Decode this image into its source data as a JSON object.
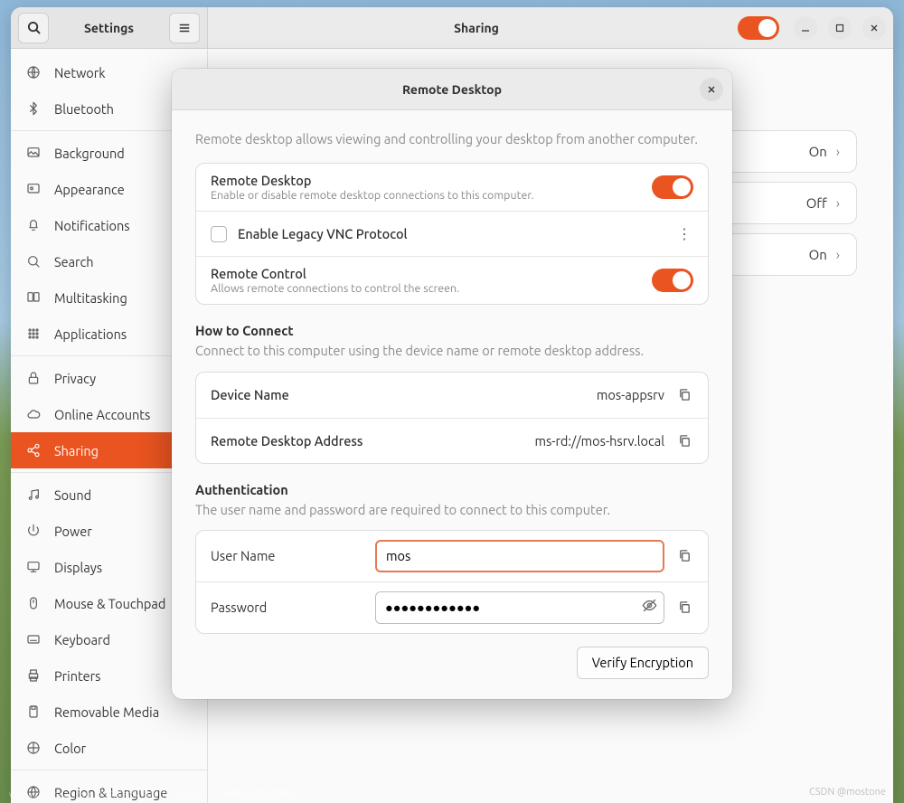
{
  "app_title": "Settings",
  "page_title": "Sharing",
  "sidebar": [
    {
      "icon": "globe",
      "label": "Network"
    },
    {
      "icon": "bluetooth",
      "label": "Bluetooth"
    },
    {
      "sep": true
    },
    {
      "icon": "background",
      "label": "Background"
    },
    {
      "icon": "appearance",
      "label": "Appearance"
    },
    {
      "icon": "bell",
      "label": "Notifications"
    },
    {
      "icon": "search",
      "label": "Search"
    },
    {
      "icon": "multitask",
      "label": "Multitasking"
    },
    {
      "icon": "apps",
      "label": "Applications"
    },
    {
      "sep": true
    },
    {
      "icon": "lock",
      "label": "Privacy"
    },
    {
      "icon": "cloud",
      "label": "Online Accounts"
    },
    {
      "icon": "share",
      "label": "Sharing",
      "active": true
    },
    {
      "sep": true
    },
    {
      "icon": "sound",
      "label": "Sound"
    },
    {
      "icon": "power",
      "label": "Power"
    },
    {
      "icon": "display",
      "label": "Displays"
    },
    {
      "icon": "mouse",
      "label": "Mouse & Touchpad"
    },
    {
      "icon": "keyboard",
      "label": "Keyboard"
    },
    {
      "icon": "printer",
      "label": "Printers"
    },
    {
      "icon": "removable",
      "label": "Removable Media"
    },
    {
      "icon": "color",
      "label": "Color"
    },
    {
      "sep": true
    },
    {
      "icon": "region",
      "label": "Region & Language"
    }
  ],
  "background_rows": [
    {
      "state": "On"
    },
    {
      "state": "Off"
    },
    {
      "state": "On"
    }
  ],
  "dialog": {
    "title": "Remote Desktop",
    "intro": "Remote desktop allows viewing and controlling your desktop from another computer.",
    "rd_title": "Remote Desktop",
    "rd_sub": "Enable or disable remote desktop connections to this computer.",
    "vnc_label": "Enable Legacy VNC Protocol",
    "rc_title": "Remote Control",
    "rc_sub": "Allows remote connections to control the screen.",
    "how_title": "How to Connect",
    "how_sub": "Connect to this computer using the device name or remote desktop address.",
    "device_name_label": "Device Name",
    "device_name_value": "mos-appsrv",
    "address_label": "Remote Desktop Address",
    "address_value": "ms-rd://mos-hsrv.local",
    "auth_title": "Authentication",
    "auth_sub": "The user name and password are required to connect to this computer.",
    "username_label": "User Name",
    "username_value": "mos",
    "password_label": "Password",
    "password_value": "●●●●●●●●●●●●",
    "verify_button": "Verify Encryption"
  },
  "watermark": "CSDN @mostone",
  "watermark2": "www.toymoban.com 网络图片仅供展示，非存储，如有侵权请联系删除"
}
